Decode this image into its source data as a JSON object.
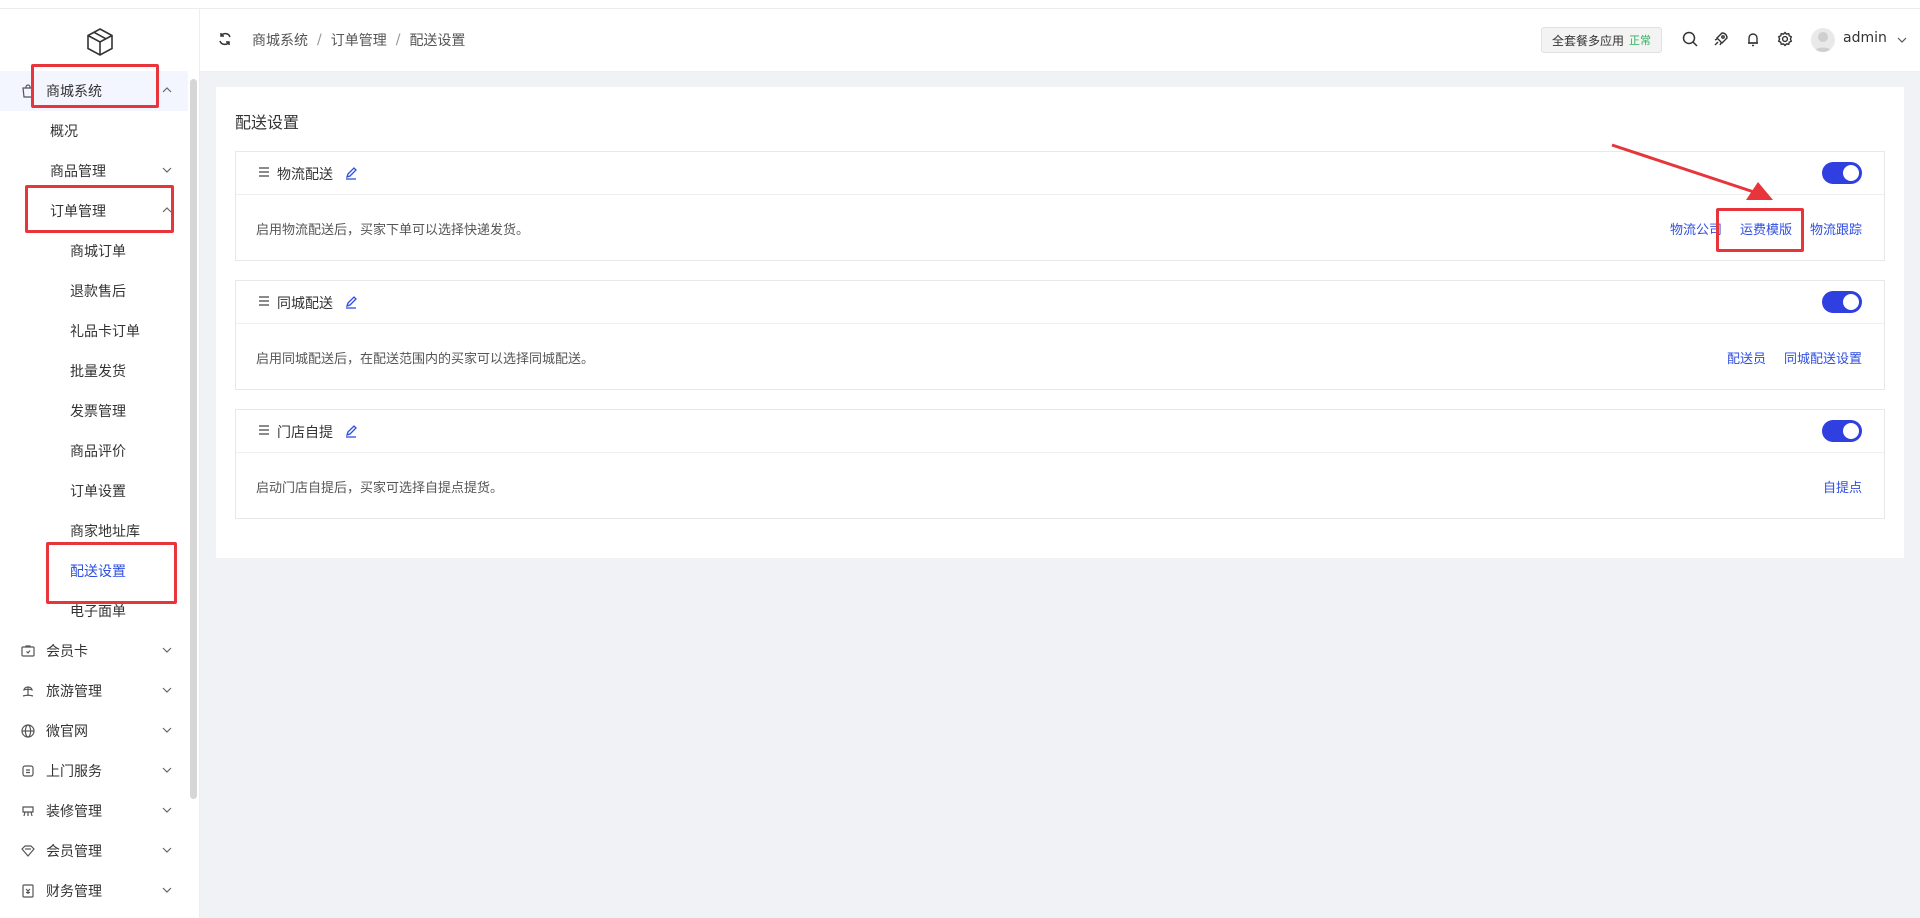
{
  "breadcrumb": [
    "商城系统",
    "订单管理",
    "配送设置"
  ],
  "header": {
    "package_label": "全套餐多应用",
    "package_status": "正常",
    "username": "admin"
  },
  "sidebar": {
    "items": [
      {
        "label": "商城系统",
        "level": 1,
        "icon": "bag-icon",
        "expanded": true
      },
      {
        "label": "概况",
        "level": 2
      },
      {
        "label": "商品管理",
        "level": 2,
        "expandable": true
      },
      {
        "label": "订单管理",
        "level": 2,
        "expanded": true
      },
      {
        "label": "商城订单",
        "level": 3
      },
      {
        "label": "退款售后",
        "level": 3
      },
      {
        "label": "礼品卡订单",
        "level": 3
      },
      {
        "label": "批量发货",
        "level": 3
      },
      {
        "label": "发票管理",
        "level": 3
      },
      {
        "label": "商品评价",
        "level": 3
      },
      {
        "label": "订单设置",
        "level": 3
      },
      {
        "label": "商家地址库",
        "level": 3
      },
      {
        "label": "配送设置",
        "level": 3,
        "active": true
      },
      {
        "label": "电子面单",
        "level": 3
      },
      {
        "label": "会员卡",
        "level": 1,
        "icon": "card-icon"
      },
      {
        "label": "旅游管理",
        "level": 1,
        "icon": "travel-icon"
      },
      {
        "label": "微官网",
        "level": 1,
        "icon": "globe-icon"
      },
      {
        "label": "上门服务",
        "level": 1,
        "icon": "service-icon"
      },
      {
        "label": "装修管理",
        "level": 1,
        "icon": "decorate-icon"
      },
      {
        "label": "会员管理",
        "level": 1,
        "icon": "member-icon"
      },
      {
        "label": "财务管理",
        "level": 1,
        "icon": "finance-icon"
      }
    ]
  },
  "main": {
    "title": "配送设置",
    "cards": [
      {
        "name": "物流配送",
        "enabled": true,
        "desc": "启用物流配送后，买家下单可以选择快递发货。",
        "links": [
          "物流公司",
          "运费模版",
          "物流跟踪"
        ]
      },
      {
        "name": "同城配送",
        "enabled": true,
        "desc": "启用同城配送后，在配送范围内的买家可以选择同城配送。",
        "links": [
          "配送员",
          "同城配送设置"
        ]
      },
      {
        "name": "门店自提",
        "enabled": true,
        "desc": "启动门店自提后，买家可选择自提点提货。",
        "links": [
          "自提点"
        ]
      }
    ]
  },
  "colors": {
    "accent": "#2f4ee0",
    "toggle_on": "#2f3fe0",
    "highlight_box": "#e8353b",
    "status_ok": "#2db35d"
  }
}
